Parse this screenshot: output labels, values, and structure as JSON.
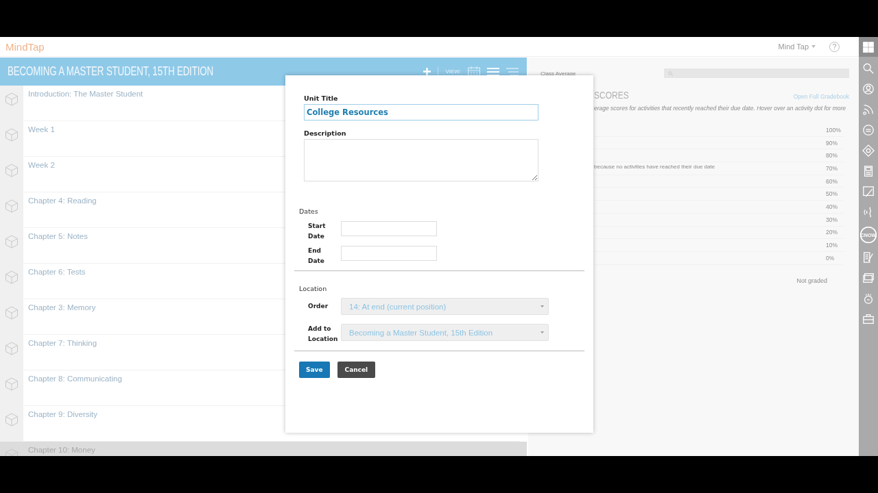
{
  "app": {
    "logo": "MindTap",
    "account_menu": "Mind Tap",
    "help": "?"
  },
  "course": {
    "title": "BECOMING A MASTER STUDENT, 15TH EDITION",
    "view_label": "VIEW:",
    "units": [
      {
        "title": "Introduction: The Master Student",
        "selected": false
      },
      {
        "title": "Week 1",
        "selected": false
      },
      {
        "title": "Week 2",
        "selected": false
      },
      {
        "title": "Chapter 4: Reading",
        "selected": false
      },
      {
        "title": "Chapter 5: Notes",
        "selected": false
      },
      {
        "title": "Chapter 6: Tests",
        "selected": false
      },
      {
        "title": "Chapter 3: Memory",
        "selected": false
      },
      {
        "title": "Chapter 7: Thinking",
        "selected": false
      },
      {
        "title": "Chapter 8: Communicating",
        "selected": false
      },
      {
        "title": "Chapter 9: Diversity",
        "selected": false
      },
      {
        "title": "Chapter 10: Money",
        "selected": true
      }
    ]
  },
  "scores": {
    "filter_label": "Class Average",
    "title": "SCORES",
    "link": "Open Full Gradebook",
    "description": "erage scores for activities that recently reached their due date. Hover over an activity dot for more",
    "empty_message": "because no activities have reached their due date",
    "y_axis_labels": [
      "100%",
      "90%",
      "80%",
      "70%",
      "60%",
      "50%",
      "40%",
      "30%",
      "20%",
      "10%",
      "0%"
    ],
    "not_graded": "Not graded"
  },
  "rail": [
    {
      "kind": "grid"
    },
    {
      "kind": "search"
    },
    {
      "kind": "person"
    },
    {
      "kind": "feed"
    },
    {
      "kind": "badge"
    },
    {
      "kind": "diamond"
    },
    {
      "kind": "book"
    },
    {
      "kind": "chart-pen"
    },
    {
      "kind": "wave"
    },
    {
      "kind": "cnow",
      "label": "CNOW"
    },
    {
      "kind": "notes"
    },
    {
      "kind": "cards"
    },
    {
      "kind": "timer"
    },
    {
      "kind": "briefcase"
    }
  ],
  "dialog": {
    "unit_title_label": "Unit Title",
    "unit_title_value": "College Resources",
    "description_label": "Description",
    "dates_heading": "Dates",
    "start_date_label": "Start Date",
    "end_date_label": "End Date",
    "location_heading": "Location",
    "order_label": "Order",
    "order_value": "14: At end (current position)",
    "add_to_label": "Add to Location",
    "add_to_value": "Becoming a Master Student, 15th Edition",
    "buttons": [
      {
        "label": "Save",
        "kind": "primary"
      },
      {
        "label": "Cancel",
        "kind": "secondary"
      }
    ]
  }
}
